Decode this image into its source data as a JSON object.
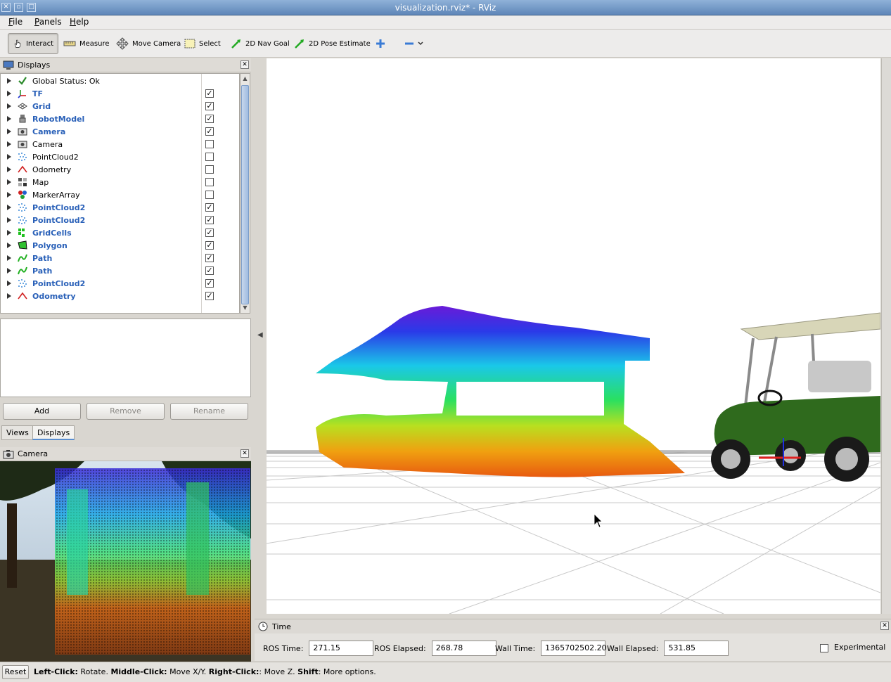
{
  "window": {
    "title": "visualization.rviz* - RViz"
  },
  "menu": [
    {
      "label": "File",
      "underline": "F",
      "rest": "ile"
    },
    {
      "label": "Panels",
      "underline": "P",
      "rest": "anels"
    },
    {
      "label": "Help",
      "underline": "H",
      "rest": "elp"
    }
  ],
  "toolbar": {
    "interact": "Interact",
    "measure": "Measure",
    "move_camera": "Move Camera",
    "select": "Select",
    "nav_goal": "2D Nav Goal",
    "pose_estimate": "2D Pose Estimate"
  },
  "displays_panel": {
    "title": "Displays",
    "items": [
      {
        "label": "Global Status: Ok",
        "icon": "check-icon",
        "enabled": false,
        "checkbox": null
      },
      {
        "label": "TF",
        "icon": "tf-axes-icon",
        "enabled": true,
        "checkbox": true
      },
      {
        "label": "Grid",
        "icon": "grid-icon",
        "enabled": true,
        "checkbox": true
      },
      {
        "label": "RobotModel",
        "icon": "robot-icon",
        "enabled": true,
        "checkbox": true
      },
      {
        "label": "Camera",
        "icon": "camera-icon",
        "enabled": true,
        "checkbox": true
      },
      {
        "label": "Camera",
        "icon": "camera-icon",
        "enabled": false,
        "checkbox": false
      },
      {
        "label": "PointCloud2",
        "icon": "pointcloud-icon",
        "enabled": false,
        "checkbox": false
      },
      {
        "label": "Odometry",
        "icon": "odometry-icon",
        "enabled": false,
        "checkbox": false
      },
      {
        "label": "Map",
        "icon": "map-icon",
        "enabled": false,
        "checkbox": false
      },
      {
        "label": "MarkerArray",
        "icon": "markerarray-icon",
        "enabled": false,
        "checkbox": false
      },
      {
        "label": "PointCloud2",
        "icon": "pointcloud-icon",
        "enabled": true,
        "checkbox": true
      },
      {
        "label": "PointCloud2",
        "icon": "pointcloud-icon",
        "enabled": true,
        "checkbox": true
      },
      {
        "label": "GridCells",
        "icon": "gridcells-icon",
        "enabled": true,
        "checkbox": true
      },
      {
        "label": "Polygon",
        "icon": "polygon-icon",
        "enabled": true,
        "checkbox": true
      },
      {
        "label": "Path",
        "icon": "path-icon",
        "enabled": true,
        "checkbox": true
      },
      {
        "label": "Path",
        "icon": "path-icon",
        "enabled": true,
        "checkbox": true
      },
      {
        "label": "PointCloud2",
        "icon": "pointcloud-icon",
        "enabled": true,
        "checkbox": true
      },
      {
        "label": "Odometry",
        "icon": "odometry-icon",
        "enabled": true,
        "checkbox": true
      }
    ],
    "buttons": {
      "add": "Add",
      "remove": "Remove",
      "rename": "Rename"
    }
  },
  "tabs": [
    {
      "label": "Views",
      "selected": false
    },
    {
      "label": "Displays",
      "selected": true
    }
  ],
  "camera_panel": {
    "title": "Camera"
  },
  "time_panel": {
    "title": "Time",
    "ros_time_label": "ROS Time:",
    "ros_time": "271.15",
    "ros_elapsed_label": "ROS Elapsed:",
    "ros_elapsed": "268.78",
    "wall_time_label": "Wall Time:",
    "wall_time": "1365702502.20",
    "wall_elapsed_label": "Wall Elapsed:",
    "wall_elapsed": "531.85",
    "experimental_label": "Experimental"
  },
  "statusbar": {
    "reset": "Reset",
    "left_click": "Left-Click:",
    "left_action": " Rotate. ",
    "middle_click": "Middle-Click:",
    "middle_action": " Move X/Y. ",
    "right_click": "Right-Click:",
    "right_action": ": Move Z. ",
    "shift": "Shift",
    "shift_action": ": More options."
  },
  "colors": {
    "enabled_text": "#2960b8",
    "grid_floor": "#c8c8c8",
    "cart_body": "#2f6a1d"
  }
}
